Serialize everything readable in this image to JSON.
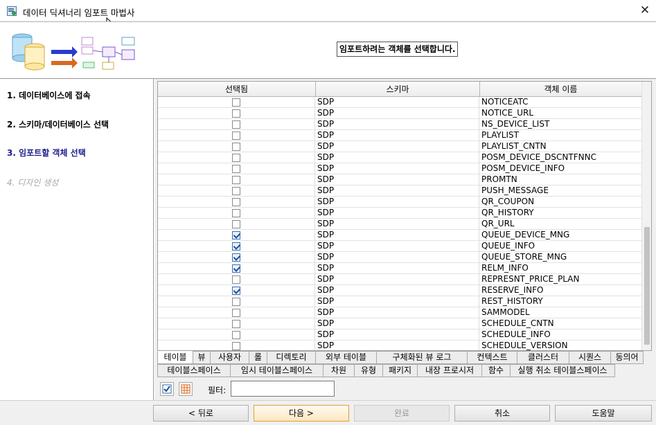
{
  "window": {
    "title": "데이터 딕셔너리 임포트 마법사",
    "close_glyph": "✕"
  },
  "banner": {
    "message": "임포트하려는 객체를 선택합니다."
  },
  "steps": [
    {
      "label": "1. 데이터베이스에 접속",
      "state": "done"
    },
    {
      "label": "2. 스키마/데이터베이스 선택",
      "state": "done"
    },
    {
      "label": "3. 임포트할 객체 선택",
      "state": "current"
    },
    {
      "label": "4. 디자인 생성",
      "state": "disabled"
    }
  ],
  "grid": {
    "columns": [
      "선택됨",
      "스키마",
      "객체 이름"
    ],
    "rows": [
      {
        "selected": false,
        "schema": "SDP",
        "name": "NOTICEATC"
      },
      {
        "selected": false,
        "schema": "SDP",
        "name": "NOTICE_URL"
      },
      {
        "selected": false,
        "schema": "SDP",
        "name": "NS_DEVICE_LIST"
      },
      {
        "selected": false,
        "schema": "SDP",
        "name": "PLAYLIST"
      },
      {
        "selected": false,
        "schema": "SDP",
        "name": "PLAYLIST_CNTN"
      },
      {
        "selected": false,
        "schema": "SDP",
        "name": "POSM_DEVICE_DSCNTFNNC"
      },
      {
        "selected": false,
        "schema": "SDP",
        "name": "POSM_DEVICE_INFO"
      },
      {
        "selected": false,
        "schema": "SDP",
        "name": "PROMTN"
      },
      {
        "selected": false,
        "schema": "SDP",
        "name": "PUSH_MESSAGE"
      },
      {
        "selected": false,
        "schema": "SDP",
        "name": "QR_COUPON"
      },
      {
        "selected": false,
        "schema": "SDP",
        "name": "QR_HISTORY"
      },
      {
        "selected": false,
        "schema": "SDP",
        "name": "QR_URL"
      },
      {
        "selected": true,
        "schema": "SDP",
        "name": "QUEUE_DEVICE_MNG"
      },
      {
        "selected": true,
        "schema": "SDP",
        "name": "QUEUE_INFO"
      },
      {
        "selected": true,
        "schema": "SDP",
        "name": "QUEUE_STORE_MNG"
      },
      {
        "selected": true,
        "schema": "SDP",
        "name": "RELM_INFO"
      },
      {
        "selected": false,
        "schema": "SDP",
        "name": "REPRESNT_PRICE_PLAN"
      },
      {
        "selected": true,
        "schema": "SDP",
        "name": "RESERVE_INFO"
      },
      {
        "selected": false,
        "schema": "SDP",
        "name": "REST_HISTORY"
      },
      {
        "selected": false,
        "schema": "SDP",
        "name": "SAMMODEL"
      },
      {
        "selected": false,
        "schema": "SDP",
        "name": "SCHEDULE_CNTN"
      },
      {
        "selected": false,
        "schema": "SDP",
        "name": "SCHEDULE_INFO"
      },
      {
        "selected": false,
        "schema": "SDP",
        "name": "SCHEDULE_VERSION"
      }
    ]
  },
  "tabs_row1": [
    "테이블",
    "뷰",
    "사용자",
    "롤",
    "디렉토리",
    "외부 테이블",
    "구체화된 뷰 로그",
    "컨텍스트",
    "클러스터",
    "시퀀스",
    "동의어"
  ],
  "tabs_row2": [
    "테이블스페이스",
    "임시 테이블스페이스",
    "차원",
    "유형",
    "패키지",
    "내장 프로시저",
    "함수",
    "실행 취소 테이블스페이스"
  ],
  "active_tab": "테이블",
  "toolbar": {
    "select_all_icon": "check-all-icon",
    "deselect_all_icon": "grid-icon",
    "filter_label": "필터:",
    "filter_value": ""
  },
  "footer": {
    "back": "< 뒤로",
    "next": "다음 >",
    "finish": "완료",
    "cancel": "취소",
    "help": "도움말"
  },
  "colors": {
    "current_step": "#1d1d8c",
    "disabled_text": "#a8a8a8",
    "primary_button_border": "#e0a030"
  }
}
